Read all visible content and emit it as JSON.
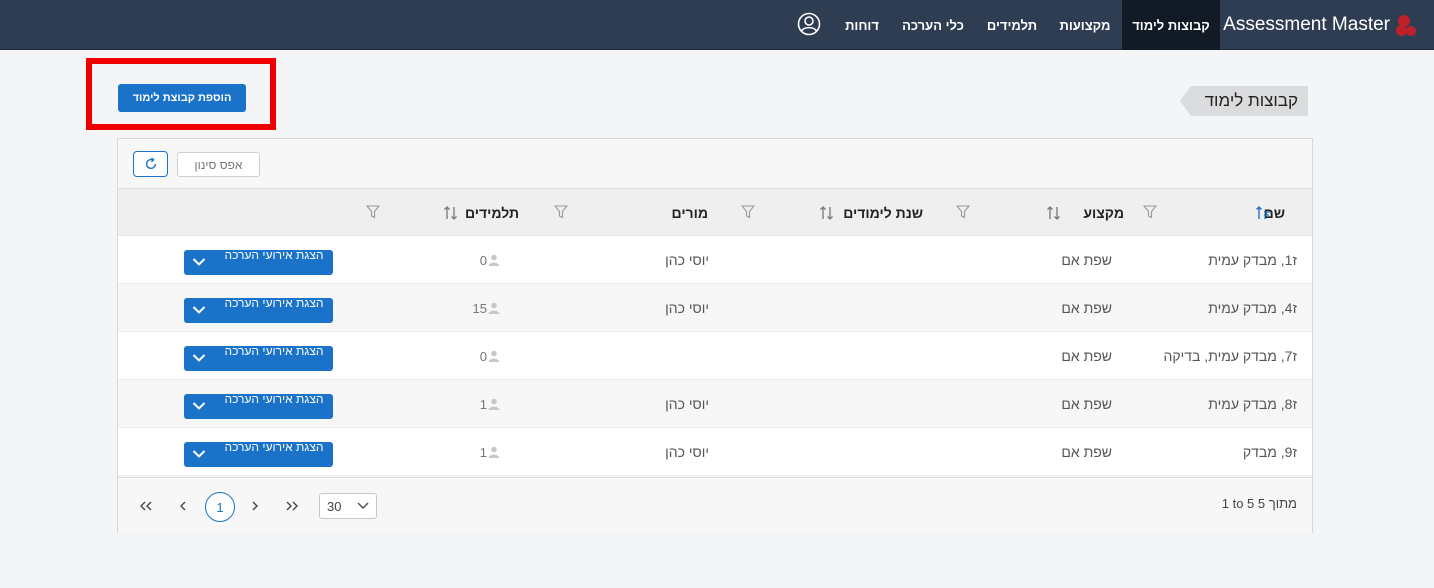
{
  "app": {
    "brand": "Assessment Master",
    "nav": [
      "קבוצות לימוד",
      "מקצועות",
      "תלמידים",
      "כלי הערכה",
      "דוחות"
    ]
  },
  "page": {
    "title": "קבוצות לימוד",
    "add_button": "הוספת קבוצת לימוד"
  },
  "toolbar": {
    "reset_filter": "אפס סינון"
  },
  "table": {
    "columns": {
      "name": "שם",
      "subject": "מקצוע",
      "year": "שנת לימודים",
      "teachers": "מורים",
      "students": "תלמידים"
    },
    "action_label": "הצגת אירועי הערכה",
    "rows": [
      {
        "name": "ז1, מבדק עמית",
        "subject": "שפת אם",
        "year": "",
        "teachers": "יוסי כהן",
        "students": "0"
      },
      {
        "name": "ז4, מבדק עמית",
        "subject": "שפת אם",
        "year": "",
        "teachers": "יוסי כהן",
        "students": "15"
      },
      {
        "name": "ז7, מבדק עמית, בדיקה",
        "subject": "שפת אם",
        "year": "",
        "teachers": "",
        "students": "0"
      },
      {
        "name": "ז8, מבדק עמית",
        "subject": "שפת אם",
        "year": "",
        "teachers": "יוסי כהן",
        "students": "1"
      },
      {
        "name": "ז9, מבדק",
        "subject": "שפת אם",
        "year": "",
        "teachers": "יוסי כהן",
        "students": "1"
      }
    ]
  },
  "pagination": {
    "current_page": "1",
    "page_size": "30",
    "info": "1 to 5 מתוך 5"
  },
  "colors": {
    "nav_bg": "#2f3d52",
    "accent": "#1a73c9",
    "highlight": "#ee0000"
  }
}
